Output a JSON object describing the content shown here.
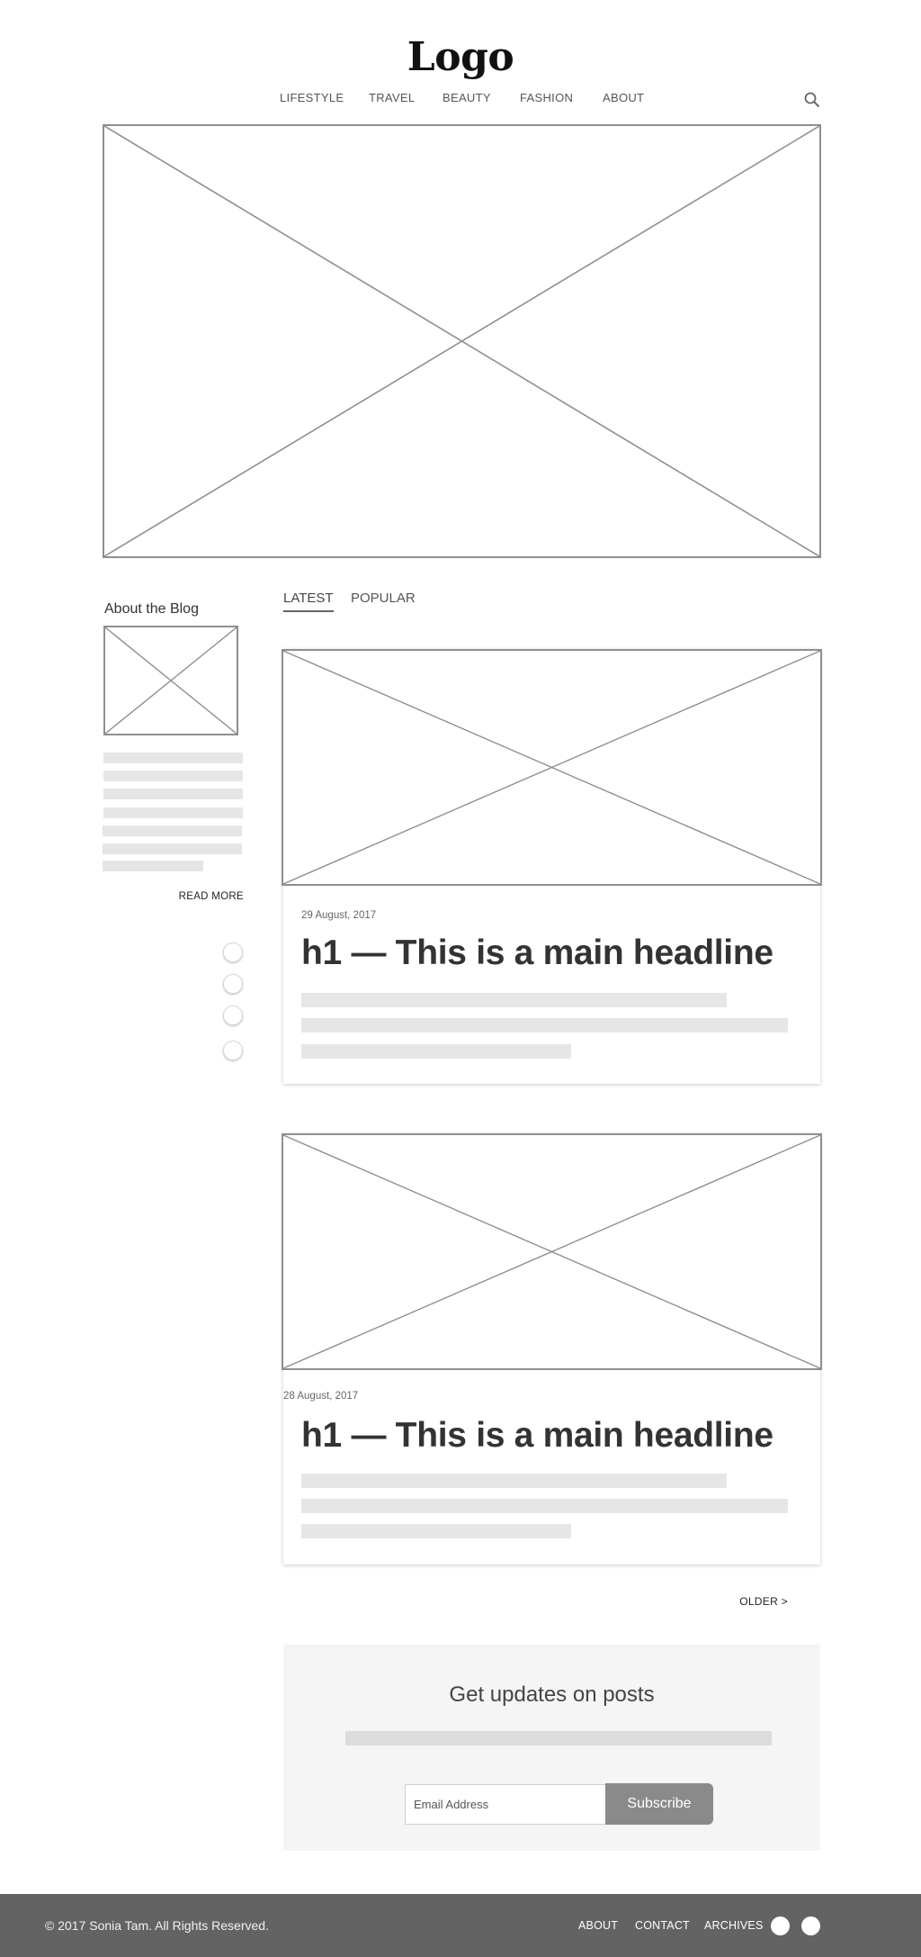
{
  "header": {
    "logo": "Logo",
    "nav": [
      "LIFESTYLE",
      "TRAVEL",
      "BEAUTY",
      "FASHION",
      "ABOUT"
    ],
    "search_icon": "search-icon"
  },
  "sidebar": {
    "about_title": "About the Blog",
    "read_more": "READ MORE",
    "social_icons": [
      "social-icon",
      "social-icon",
      "social-icon",
      "social-icon"
    ]
  },
  "tabs": [
    "LATEST",
    "POPULAR"
  ],
  "posts": [
    {
      "date": "29 August, 2017",
      "headline": "h1 — This is a main headline"
    },
    {
      "date": "28 August, 2017",
      "headline": "h1 — This is a main headline"
    }
  ],
  "pagination": {
    "older": "OLDER >"
  },
  "newsletter": {
    "title": "Get updates on posts",
    "email_placeholder": "Email Address",
    "subscribe_label": "Subscribe"
  },
  "footer": {
    "copyright": "© 2017 Sonia Tam. All Rights Reserved.",
    "links": [
      "ABOUT",
      "CONTACT",
      "ARCHIVES"
    ]
  },
  "colors": {
    "placeholder_border": "#8f8f8f",
    "footer_bg": "#636363",
    "button_bg": "#8a8a8a",
    "text_block": "#e6e6e6"
  }
}
